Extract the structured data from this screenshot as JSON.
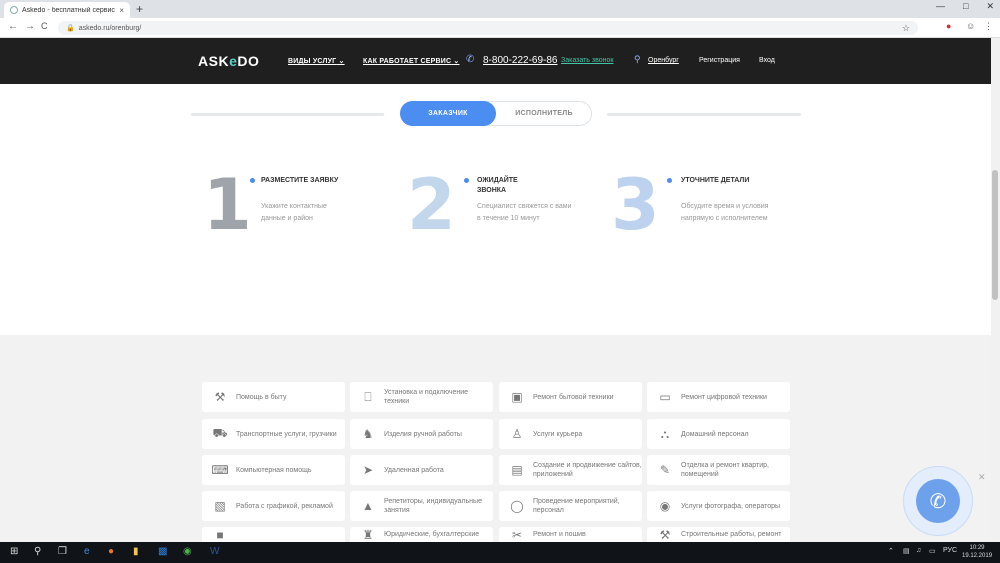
{
  "browser": {
    "tab_title": "Askedo - бесплатный сервис п",
    "tab_close": "×",
    "new_tab": "+",
    "url": "askedo.ru/orenburg/",
    "back": "←",
    "forward": "→",
    "reload": "C"
  },
  "site": {
    "logo_pre": "ASK",
    "logo_mid": "e",
    "logo_post": "DO",
    "menu": {
      "services": "ВИДЫ УСЛУГ",
      "how": "КАК РАБОТАЕТ СЕРВИС"
    },
    "phone": "8-800-222-69-86",
    "callback": "Заказать звонок",
    "city": "Оренбург",
    "register": "Регистрация",
    "login": "Вход"
  },
  "toggle": {
    "customer": "ЗАКАЗЧИК",
    "executor": "ИСПОЛНИТЕЛЬ"
  },
  "steps": [
    {
      "num": "1",
      "title": "Разместите заявку",
      "desc": "Укажите контактные данные и район"
    },
    {
      "num": "2",
      "title": "Ожидайте звонка",
      "desc": "Специалист свяжется с вами в течение 10 минут"
    },
    {
      "num": "3",
      "title": "Уточните детали",
      "desc": "Обсудите время и условия напрямую с исполнителем"
    }
  ],
  "categories": [
    {
      "label": "Помощь в быту",
      "icon": "tools-icon"
    },
    {
      "label": "Установка и подключение техники",
      "icon": "plug-icon"
    },
    {
      "label": "Ремонт бытовой техники",
      "icon": "washer-icon"
    },
    {
      "label": "Ремонт цифровой техники",
      "icon": "monitor-icon"
    },
    {
      "label": "Транспортные услуги, грузчики",
      "icon": "truck-icon"
    },
    {
      "label": "Изделия ручной работы",
      "icon": "horse-toy-icon"
    },
    {
      "label": "Услуги курьера",
      "icon": "courier-icon"
    },
    {
      "label": "Домашний персонал",
      "icon": "cloche-icon"
    },
    {
      "label": "Компьютерная помощь",
      "icon": "keyboard-icon"
    },
    {
      "label": "Удаленная работа",
      "icon": "paper-plane-icon"
    },
    {
      "label": "Создание и продвижение сайтов, приложений",
      "icon": "browser-window-icon"
    },
    {
      "label": "Отделка и ремонт квартир, помещений",
      "icon": "paint-roller-icon"
    },
    {
      "label": "Работа с графикой, рекламой",
      "icon": "graphics-icon"
    },
    {
      "label": "Репетиторы, индивидуальные занятия",
      "icon": "graduation-cap-icon"
    },
    {
      "label": "Проведение мероприятий, персонал",
      "icon": "balloons-icon"
    },
    {
      "label": "Услуги фотографа, операторы",
      "icon": "camera-icon"
    },
    {
      "label": "",
      "icon": "generic-icon"
    },
    {
      "label": "Юридические, бухгалтерские",
      "icon": "building-icon"
    },
    {
      "label": "Ремонт и пошив",
      "icon": "sewing-icon"
    },
    {
      "label": "Строительные работы, ремонт",
      "icon": "hammer-icon"
    }
  ],
  "taskbar": {
    "lang": "РУС",
    "time": "10:29",
    "date": "19.12.2019"
  },
  "colors": {
    "accent": "#4b8df0",
    "header_bg": "#1f1f1f",
    "logo_accent": "#56d1c6",
    "callback_link": "#43c6a8"
  }
}
